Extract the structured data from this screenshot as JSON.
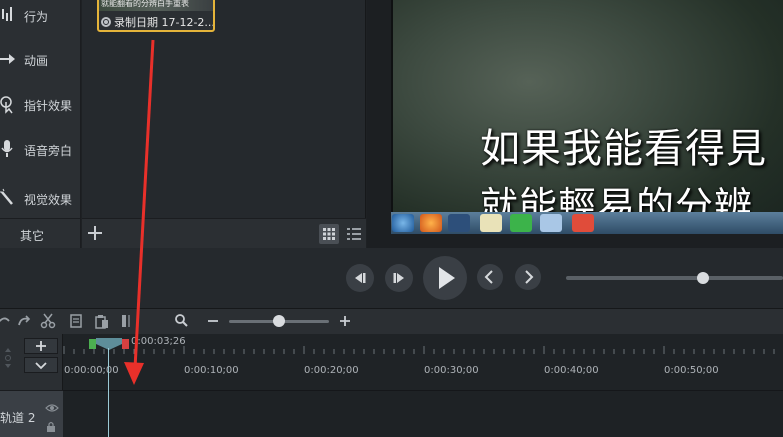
{
  "sidebar": {
    "items": [
      {
        "label": "行为",
        "icon": "behaviors-icon"
      },
      {
        "label": "动画",
        "icon": "animation-icon"
      },
      {
        "label": "指针效果",
        "icon": "cursor-effects-icon"
      },
      {
        "label": "语音旁白",
        "icon": "microphone-icon"
      },
      {
        "label": "视觉效果",
        "icon": "magic-wand-icon"
      }
    ],
    "more_label": "其它"
  },
  "media_bin": {
    "clip": {
      "thumb_text": "就能翻看的分辨白手重表",
      "record_label": "录制日期 17-12-2..."
    }
  },
  "preview": {
    "subtitle_line1": "如果我能看得見",
    "subtitle_line2": "就能輕易的分辨"
  },
  "timeline": {
    "playhead_time": "0:00:03;26",
    "ticks": [
      "0:00:00;00",
      "0:00:10;00",
      "0:00:20;00",
      "0:00:30;00",
      "0:00:40;00",
      "0:00:50;00"
    ],
    "track_label": "轨道 2"
  },
  "colors": {
    "accent_clip_border": "#e5b43a",
    "annotation_arrow": "#e8302a",
    "playhead": "#5e8e9a"
  }
}
